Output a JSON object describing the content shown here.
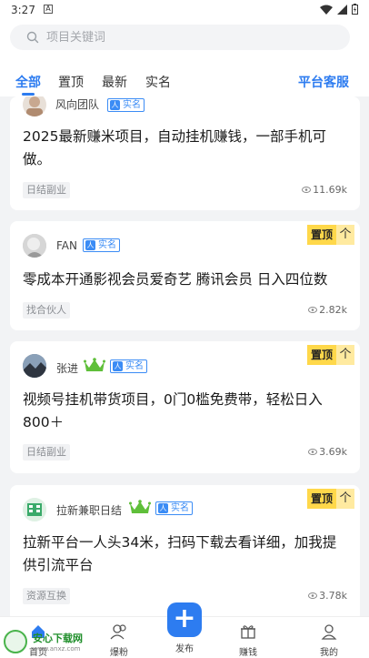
{
  "status_bar": {
    "time": "3:27",
    "a_badge": "A"
  },
  "search": {
    "placeholder": "项目关键词"
  },
  "tabs": [
    {
      "label": "全部",
      "active": true
    },
    {
      "label": "置顶",
      "active": false
    },
    {
      "label": "最新",
      "active": false
    },
    {
      "label": "实名",
      "active": false
    }
  ],
  "service_label": "平台客服",
  "posts": [
    {
      "user": "风向团队",
      "verified_label": "实名",
      "crown": false,
      "pinned": false,
      "title": "2025最新赚米项目，自动挂机赚钱，一部手机可做。",
      "tag": "日结副业",
      "views": "11.69k"
    },
    {
      "user": "FAN",
      "verified_label": "实名",
      "crown": false,
      "pinned": true,
      "pin_label": "置顶",
      "pin_arrow": "个",
      "title": "零成本开通影视会员爱奇艺 腾讯会员 日入四位数",
      "tag": "找合伙人",
      "views": "2.82k"
    },
    {
      "user": "张进",
      "verified_label": "实名",
      "crown": true,
      "pinned": true,
      "pin_label": "置顶",
      "pin_arrow": "个",
      "title": "视频号挂机带货项目，0门0槛免费带，轻松日入800＋",
      "tag": "日结副业",
      "views": "3.69k"
    },
    {
      "user": "拉新兼职日结",
      "verified_label": "实名",
      "crown": true,
      "pinned": true,
      "pin_label": "置顶",
      "pin_arrow": "个",
      "title": "拉新平台一人头34米，扫码下载去看详细，加我提供引流平台",
      "tag": "资源互换",
      "views": "3.78k"
    }
  ],
  "bottom_nav": {
    "home": "首页",
    "fans": "爆粉",
    "publish": "发布",
    "earn": "赚钱",
    "mine": "我的",
    "publish_symbol": "+"
  },
  "watermark": {
    "text": "安心下载网",
    "url": "www.anxz.com"
  }
}
